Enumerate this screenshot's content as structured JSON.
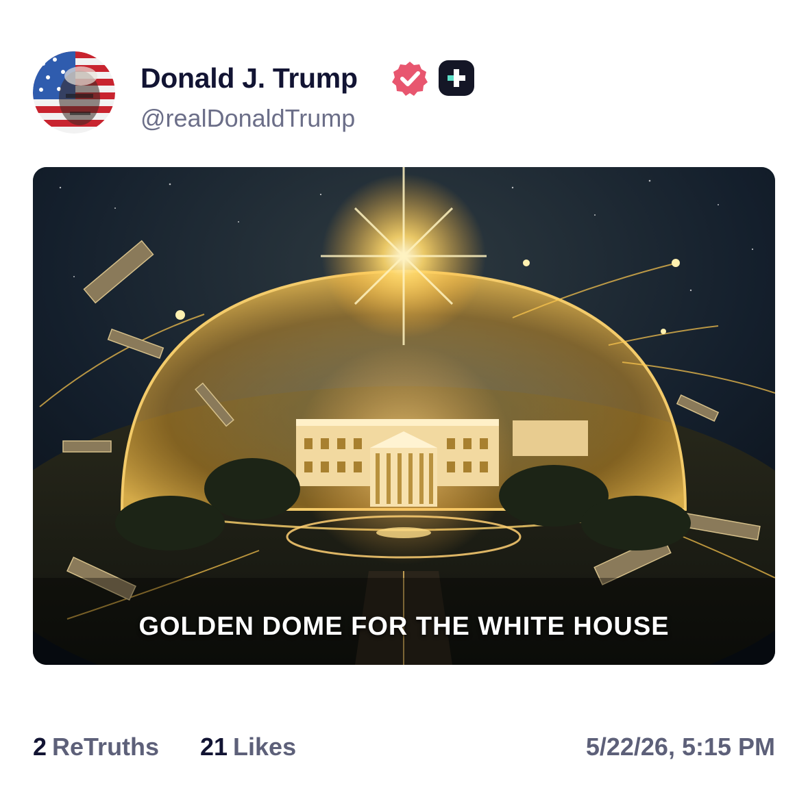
{
  "author": {
    "display_name": "Donald J. Trump",
    "handle": "@realDonaldTrump",
    "avatar_icon": "flag-portrait-avatar",
    "verified_icon": "verified-badge-icon",
    "plus_icon": "truth-plus-icon"
  },
  "media": {
    "caption": "GOLDEN DOME FOR THE WHITE HOUSE"
  },
  "stats": {
    "retruths_count": "2",
    "retruths_label": "ReTruths",
    "likes_count": "21",
    "likes_label": "Likes"
  },
  "timestamp": "5/22/26, 5:15 PM",
  "colors": {
    "name": "#121433",
    "muted": "#6b6e88",
    "verified": "#e8566f",
    "plus_bg": "#141626",
    "plus_accent": "#5de0c8"
  }
}
